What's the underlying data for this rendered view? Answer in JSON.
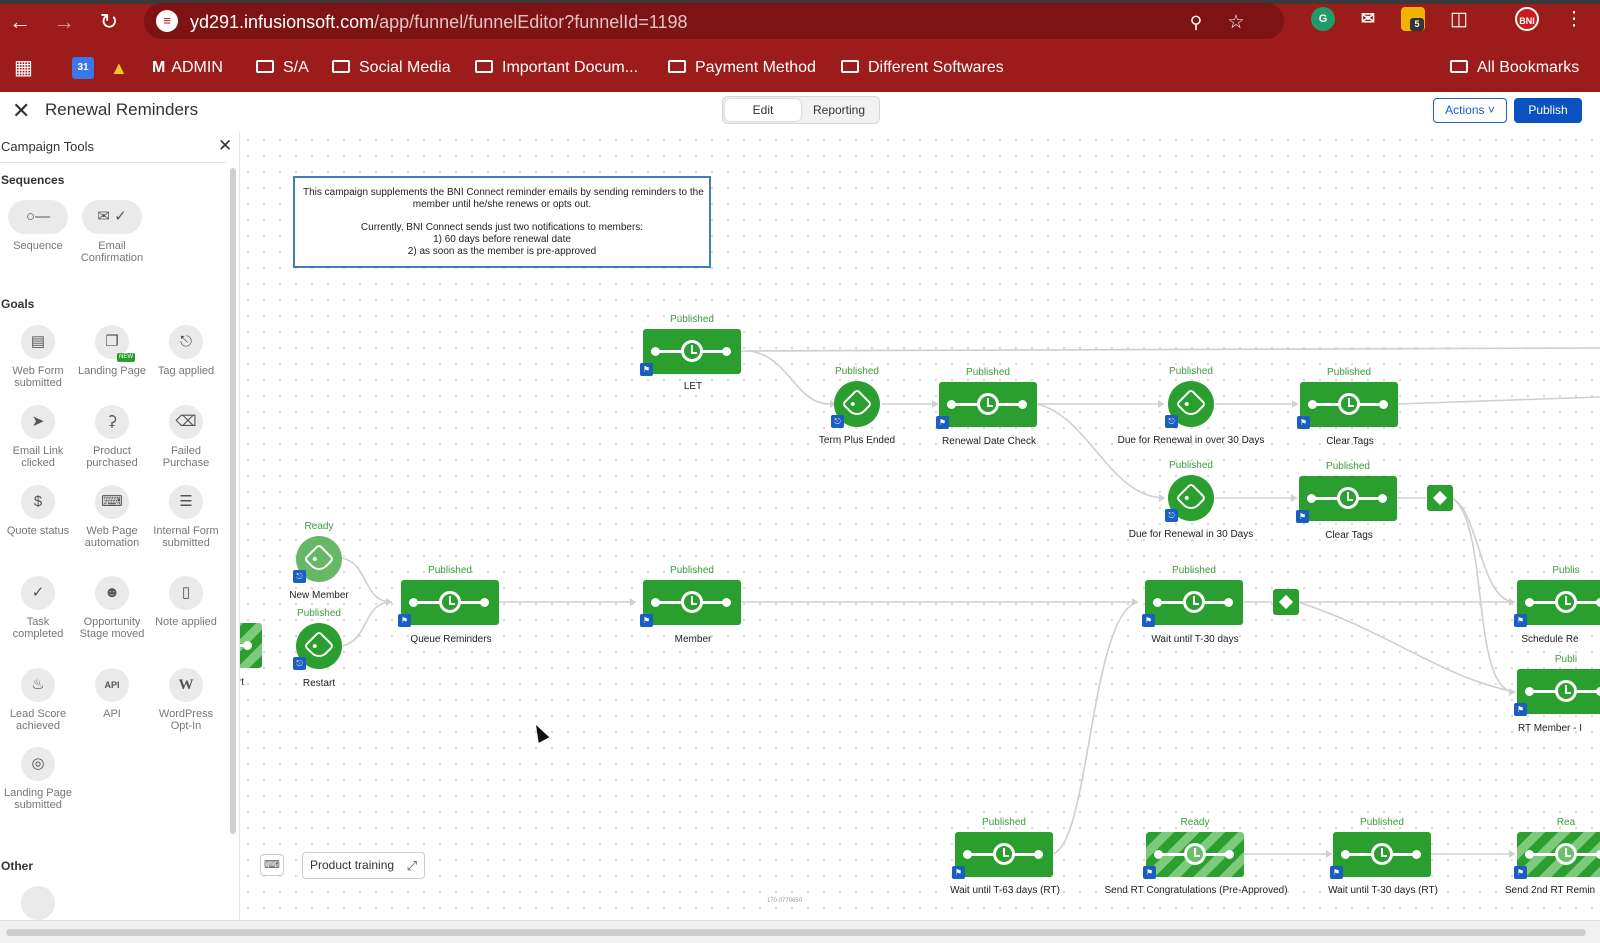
{
  "browser": {
    "url_host": "yd291.infusionsoft.com",
    "url_path": "/app/funnel/funnelEditor?funnelId=1198",
    "extension_badge": "5",
    "profile": "BNI",
    "bookmarks": [
      "ADMIN",
      "S/A",
      "Social Media",
      "Important Docum...",
      "Payment Method",
      "Different Softwares"
    ],
    "all_bookmarks": "All Bookmarks",
    "calendar_day": "31",
    "theme_color": "#9c1b1b"
  },
  "app": {
    "title": "Renewal Reminders",
    "tabs": [
      "Edit",
      "Reporting"
    ],
    "active_tab": "Edit",
    "actions_label": "Actions",
    "publish_label": "Publish",
    "accent_color": "#0a52c2"
  },
  "panel": {
    "title": "Campaign Tools",
    "sections": {
      "sequences": "Sequences",
      "goals": "Goals",
      "other": "Other"
    },
    "sequence_tools": [
      {
        "label": "Sequence",
        "icon": "sequence-icon"
      },
      {
        "label": "Email Confirmation",
        "icon": "email-confirmation-icon"
      }
    ],
    "goal_tools": [
      {
        "label": "Web Form submitted",
        "icon": "web-form-icon"
      },
      {
        "label": "Landing Page",
        "icon": "landing-page-icon",
        "badge": "NEW"
      },
      {
        "label": "Tag applied",
        "icon": "tag-icon"
      },
      {
        "label": "Email Link clicked",
        "icon": "cursor-icon"
      },
      {
        "label": "Product purchased",
        "icon": "cart-icon"
      },
      {
        "label": "Failed Purchase",
        "icon": "failed-card-icon"
      },
      {
        "label": "Quote status",
        "icon": "dollar-icon"
      },
      {
        "label": "Web Page automation",
        "icon": "web-page-icon"
      },
      {
        "label": "Internal Form submitted",
        "icon": "form-icon"
      },
      {
        "label": "Task completed",
        "icon": "check-icon"
      },
      {
        "label": "Opportunity Stage moved",
        "icon": "person-icon"
      },
      {
        "label": "Note applied",
        "icon": "note-icon"
      },
      {
        "label": "Lead Score achieved",
        "icon": "flame-icon"
      },
      {
        "label": "API",
        "icon": "api-icon"
      },
      {
        "label": "WordPress Opt-In",
        "icon": "wordpress-icon"
      },
      {
        "label": "Landing Page submitted",
        "icon": "target-icon"
      }
    ]
  },
  "canvas": {
    "note_lines": [
      "This campaign supplements the BNI Connect reminder emails by sending reminders to the",
      "member until he/she renews or opts out.",
      "",
      "Currently, BNI Connect sends just two notifications to members:",
      "1) 60 days before renewal date",
      "2) as soon as the member is pre-approved"
    ],
    "nodes": [
      {
        "id": "let",
        "type": "sequence",
        "status": "Published",
        "label": "LET"
      },
      {
        "id": "term",
        "type": "goal",
        "status": "Published",
        "label": "Term Plus Ended"
      },
      {
        "id": "rdc",
        "type": "sequence",
        "status": "Published",
        "label": "Renewal Date Check"
      },
      {
        "id": "due30p",
        "type": "goal",
        "status": "Published",
        "label": "Due for Renewal in over 30 Days"
      },
      {
        "id": "clear1",
        "type": "sequence",
        "status": "Published",
        "label": "Clear Tags"
      },
      {
        "id": "due30",
        "type": "goal",
        "status": "Published",
        "label": "Due for Renewal in 30 Days"
      },
      {
        "id": "clear2",
        "type": "sequence",
        "status": "Published",
        "label": "Clear Tags"
      },
      {
        "id": "newmember",
        "type": "goal",
        "status": "Ready",
        "label": "New Member"
      },
      {
        "id": "restart",
        "type": "goal",
        "status": "Published",
        "label": "Restart"
      },
      {
        "id": "queue",
        "type": "sequence",
        "status": "Published",
        "label": "Queue Reminders"
      },
      {
        "id": "member",
        "type": "sequence",
        "status": "Published",
        "label": "Member"
      },
      {
        "id": "t30",
        "type": "sequence",
        "status": "Published",
        "label": "Wait until T-30 days"
      },
      {
        "id": "sched",
        "type": "sequence",
        "status": "Publis",
        "label": "Schedule Re"
      },
      {
        "id": "rtmem",
        "type": "sequence",
        "status": "Publi",
        "label": "RT Member - I"
      },
      {
        "id": "t63",
        "type": "sequence",
        "status": "Published",
        "label": "Wait until T-63 days (RT)"
      },
      {
        "id": "rtcongr",
        "type": "sequence",
        "status": "Ready",
        "label": "Send RT Congratulations (Pre-Approved)"
      },
      {
        "id": "t30rt",
        "type": "sequence",
        "status": "Published",
        "label": "Wait until T-30 days (RT)"
      },
      {
        "id": "send2nd",
        "type": "sequence",
        "status": "Rea",
        "label": "Send 2nd RT Remin"
      },
      {
        "id": "offleft",
        "type": "sequence",
        "status": "",
        "label": "rt"
      }
    ],
    "product_training": "Product training",
    "zoom_readout": "170.0770650"
  }
}
